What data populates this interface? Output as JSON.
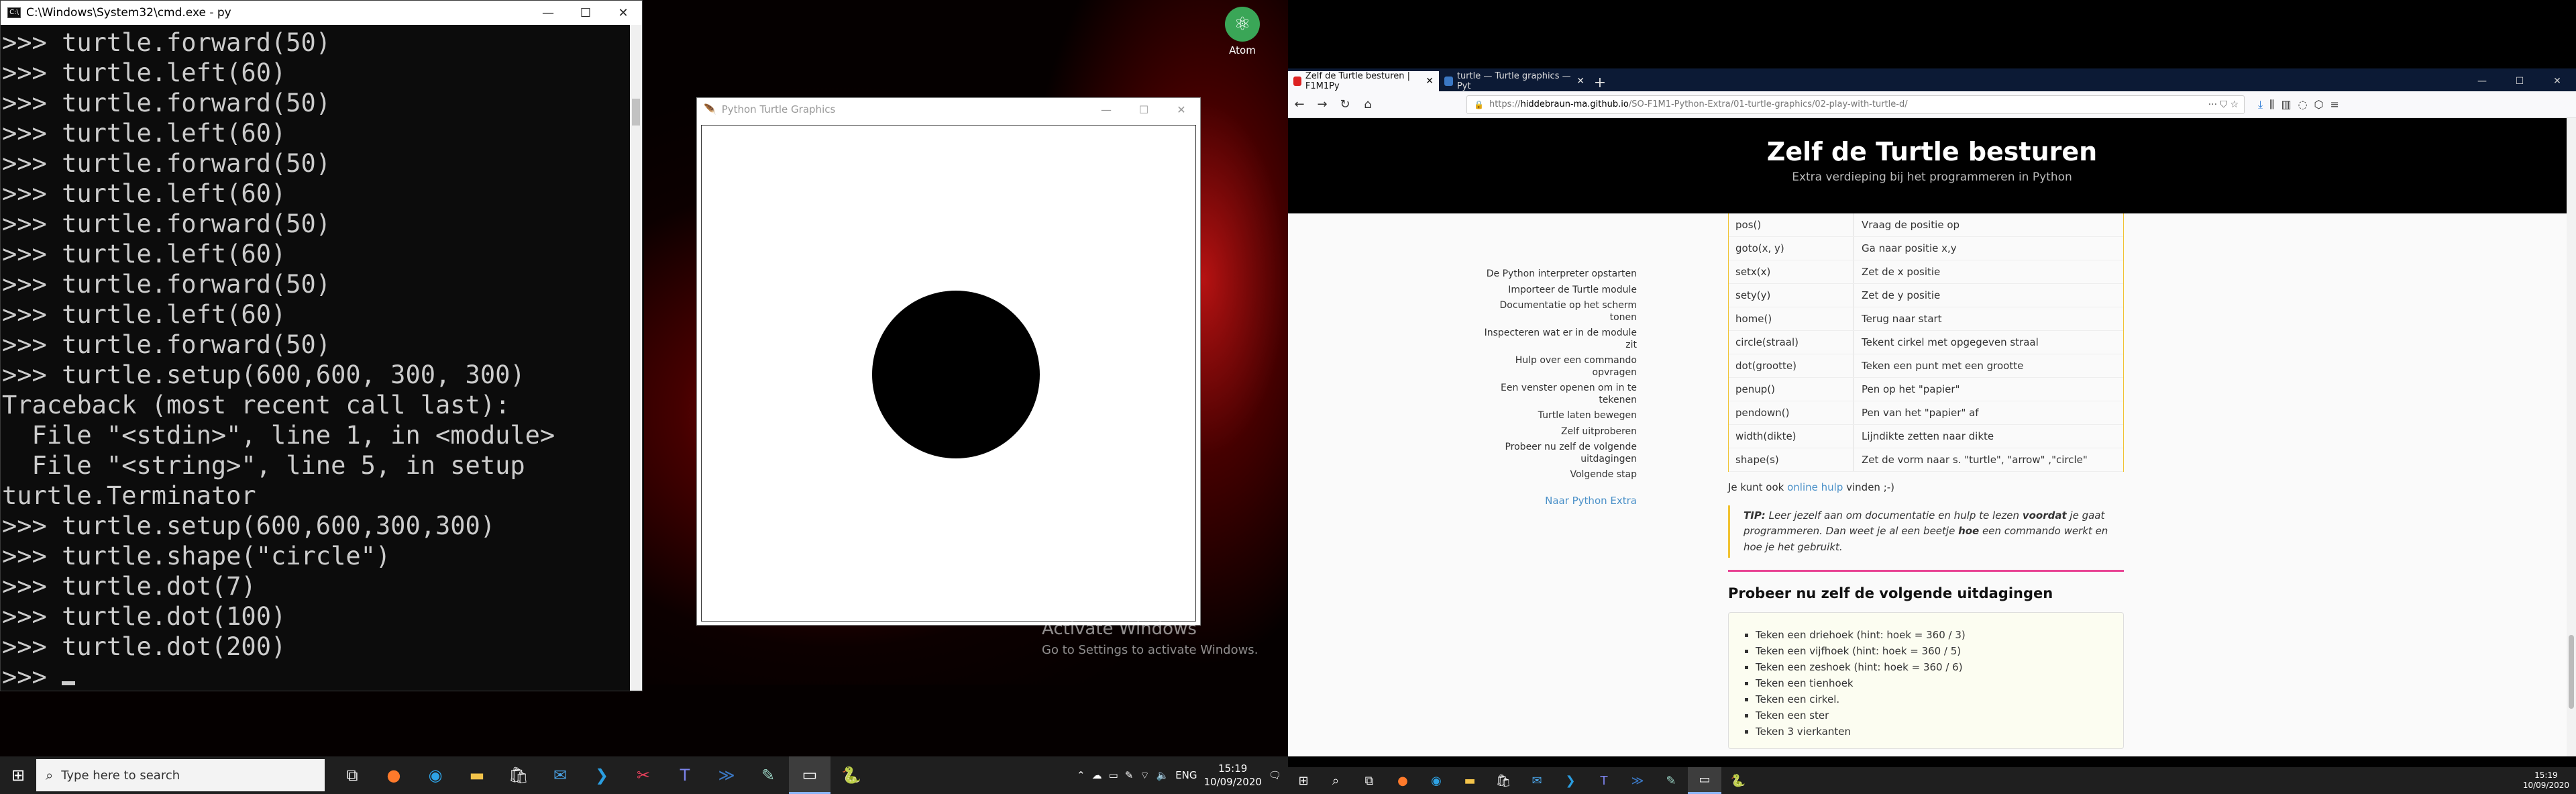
{
  "cmd": {
    "title": "C:\\Windows\\System32\\cmd.exe - py",
    "lines": [
      ">>> turtle.forward(50)",
      ">>> turtle.left(60)",
      ">>> turtle.forward(50)",
      ">>> turtle.left(60)",
      ">>> turtle.forward(50)",
      ">>> turtle.left(60)",
      ">>> turtle.forward(50)",
      ">>> turtle.left(60)",
      ">>> turtle.forward(50)",
      ">>> turtle.left(60)",
      ">>> turtle.forward(50)",
      ">>> turtle.setup(600,600, 300, 300)",
      "Traceback (most recent call last):",
      "  File \"<stdin>\", line 1, in <module>",
      "  File \"<string>\", line 5, in setup",
      "turtle.Terminator",
      ">>> turtle.setup(600,600,300,300)",
      ">>> turtle.shape(\"circle\")",
      ">>> turtle.dot(7)",
      ">>> turtle.dot(100)",
      ">>> turtle.dot(200)"
    ],
    "prompt": ">>> "
  },
  "turtle_window": {
    "title": "Python Turtle Graphics"
  },
  "desktop": {
    "atom_label": "Atom",
    "activate_title": "Activate Windows",
    "activate_sub": "Go to Settings to activate Windows."
  },
  "taskbar_left": {
    "search_placeholder": "Type here to search",
    "language": "ENG",
    "time": "15:19",
    "date": "10/09/2020"
  },
  "browser": {
    "tabs": [
      {
        "label": "Zelf de Turtle besturen | F1M1Py"
      },
      {
        "label": "turtle — Turtle graphics — Pyt"
      }
    ],
    "url_host": "hiddebraun-ma.github.io",
    "url_prefix": "https://",
    "url_path": "/SO-F1M1-Python-Extra/01-turtle-graphics/02-play-with-turtle-d/",
    "site_title": "Zelf de Turtle besturen",
    "site_subtitle": "Extra verdieping bij het programmeren in Python",
    "toc": [
      "De Python interpreter opstarten",
      "Importeer de Turtle module",
      "Documentatie op het scherm tonen",
      "Inspecteren wat er in de module zit",
      "Hulp over een commando opvragen",
      "Een venster openen om in te tekenen",
      "Turtle laten bewegen",
      "Zelf uitproberen",
      "Probeer nu zelf de volgende uitdagingen",
      "Volgende stap"
    ],
    "toc_link": "Naar Python Extra",
    "commands": [
      {
        "cmd": "pos()",
        "desc": "Vraag de positie op"
      },
      {
        "cmd": "goto(x, y)",
        "desc": "Ga naar positie x,y"
      },
      {
        "cmd": "setx(x)",
        "desc": "Zet de x positie"
      },
      {
        "cmd": "sety(y)",
        "desc": "Zet de y positie"
      },
      {
        "cmd": "home()",
        "desc": "Terug naar start"
      },
      {
        "cmd": "circle(straal)",
        "desc": "Tekent cirkel met opgegeven straal"
      },
      {
        "cmd": "dot(grootte)",
        "desc": "Teken een punt met een grootte"
      },
      {
        "cmd": "penup()",
        "desc": "Pen op het \"papier\""
      },
      {
        "cmd": "pendown()",
        "desc": "Pen van het \"papier\" af"
      },
      {
        "cmd": "width(dikte)",
        "desc": "Lijndikte zetten naar dikte"
      },
      {
        "cmd": "shape(s)",
        "desc": "Zet de vorm naar s. \"turtle\", \"arrow\" ,\"circle\""
      }
    ],
    "help_before": "Je kunt ook ",
    "help_link": "online hulp",
    "help_after": " vinden ;-)",
    "tip_label": "TIP:",
    "tip_1": " Leer jezelf aan om documentatie en hulp te lezen ",
    "tip_bold1": "voordat",
    "tip_2": " je gaat programmeren. Dan weet je al een beetje ",
    "tip_bold2": "hoe",
    "tip_3": " een commando werkt en hoe je het gebruikt.",
    "challenge_title": "Probeer nu zelf de volgende uitdagingen",
    "challenges": [
      "Teken een driehoek (hint: hoek = 360 / 3)",
      "Teken een vijfhoek (hint: hoek = 360 / 5)",
      "Teken een zeshoek (hint: hoek = 360 / 6)",
      "Teken een tienhoek",
      "Teken een cirkel.",
      "Teken een ster",
      "Teken 3 vierkanten"
    ]
  },
  "taskbar_right": {
    "time": "15:19",
    "date": "10/09/2020"
  }
}
